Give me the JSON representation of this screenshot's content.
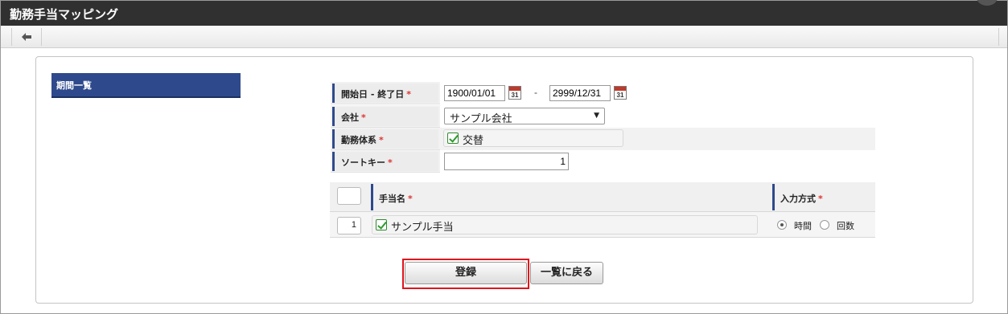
{
  "window": {
    "title": "勤務手当マッピング"
  },
  "sidebar": {
    "tab_label": "期間一覧"
  },
  "form": {
    "period": {
      "label": "開始日 - 終了日",
      "start": "1900/01/01",
      "separator": "-",
      "end": "2999/12/31",
      "calendar_day": "31"
    },
    "company": {
      "label": "会社",
      "value": "サンプル会社"
    },
    "work_system": {
      "label": "勤務体系",
      "value": "交替",
      "checked": true
    },
    "sort_key": {
      "label": "ソートキー",
      "value": "1"
    },
    "required_mark": "*"
  },
  "grid": {
    "columns": {
      "name": "手当名",
      "input_method": "入力方式"
    },
    "rows": [
      {
        "num": "1",
        "name": "サンプル手当",
        "checked": true,
        "options": [
          "時間",
          "回数"
        ],
        "selected": "時間"
      }
    ]
  },
  "actions": {
    "register": "登録",
    "back_to_list": "一覧に戻る"
  },
  "colors": {
    "accent": "#2e4a8c",
    "highlight": "#e0141c",
    "title_bg": "#303030"
  },
  "icons": [
    "back-arrow-icon",
    "calendar-icon",
    "checkbox-icon",
    "radio-icon"
  ]
}
